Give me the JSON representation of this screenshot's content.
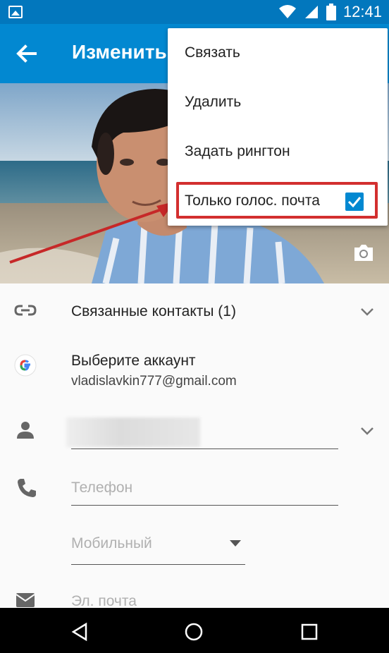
{
  "status_bar": {
    "time": "12:41",
    "icons": [
      "gallery-icon",
      "wifi-icon",
      "signal-icon",
      "battery-icon"
    ]
  },
  "app_bar": {
    "title": "Изменить",
    "back_icon": "arrow-back-icon"
  },
  "photo": {
    "camera_icon": "camera-icon"
  },
  "overflow_menu": {
    "items": [
      {
        "label": "Связать"
      },
      {
        "label": "Удалить"
      },
      {
        "label": "Задать рингтон"
      },
      {
        "label": "Только голос. почта",
        "checked": true
      }
    ]
  },
  "form": {
    "linked_contacts": "Связанные контакты (1)",
    "account_title": "Выберите аккаунт",
    "account_email": "vladislavkin777@gmail.com",
    "phone_placeholder": "Телефон",
    "phone_type": "Мобильный",
    "email_placeholder": "Эл. почта"
  },
  "colors": {
    "status_bar": "#0277bd",
    "app_bar": "#0288d1",
    "highlight": "#d32f2f",
    "accent": "#0288d1"
  }
}
